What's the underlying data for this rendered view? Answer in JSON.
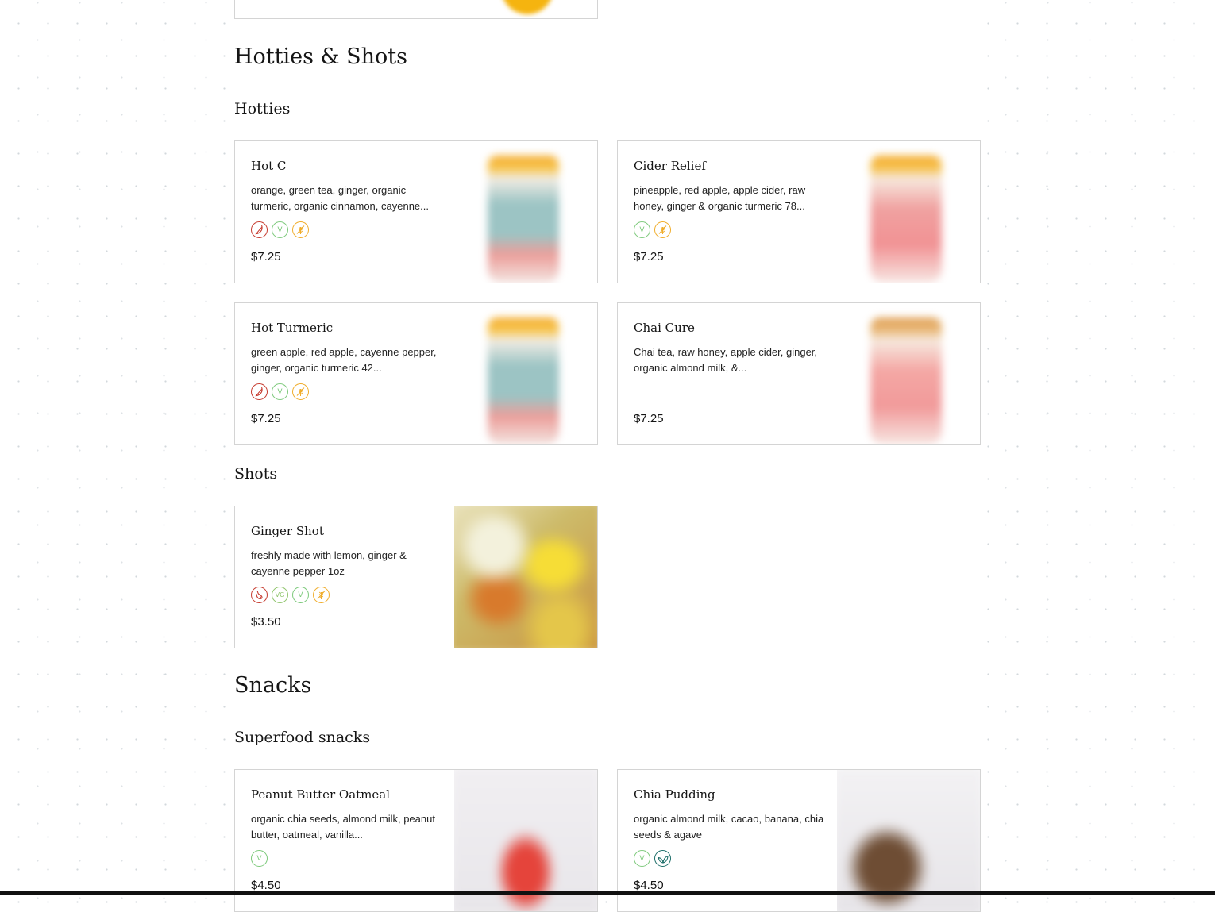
{
  "sections": [
    {
      "title": "Hotties & Shots",
      "subsections": [
        {
          "title": "Hotties",
          "items": [
            {
              "name": "Hot C",
              "desc": "orange, green tea, ginger, organic turmeric, organic cinnamon, cayenne...",
              "price": "$7.25",
              "badges": [
                "spicy-icon",
                "vegan-icon",
                "gluten-free-icon"
              ]
            },
            {
              "name": "Cider Relief",
              "desc": "pineapple, red apple, apple cider, raw honey, ginger & organic turmeric 78...",
              "price": "$7.25",
              "badges": [
                "vegan-icon",
                "gluten-free-icon"
              ]
            },
            {
              "name": "Hot Turmeric",
              "desc": "green apple, red apple, cayenne pepper, ginger, organic turmeric 42...",
              "price": "$7.25",
              "badges": [
                "spicy-icon",
                "vegan-icon",
                "gluten-free-icon"
              ]
            },
            {
              "name": "Chai Cure",
              "desc": "Chai tea, raw honey, apple cider, ginger, organic almond milk, &...",
              "price": "$7.25",
              "badges": []
            }
          ]
        },
        {
          "title": "Shots",
          "items": [
            {
              "name": "Ginger Shot",
              "desc": "freshly made with lemon, ginger & cayenne pepper 1oz",
              "price": "$3.50",
              "badges": [
                "spicy-icon",
                "vegetarian-icon",
                "vegan-icon",
                "gluten-free-icon"
              ]
            }
          ]
        }
      ]
    },
    {
      "title": "Snacks",
      "subsections": [
        {
          "title": "Superfood snacks",
          "items": [
            {
              "name": "Peanut Butter Oatmeal",
              "desc": "organic chia seeds, almond milk, peanut butter, oatmeal, vanilla...",
              "price": "$4.50",
              "badges": [
                "vegan-icon"
              ]
            },
            {
              "name": "Chia Pudding",
              "desc": "organic almond milk, cacao, banana, chia seeds & agave",
              "price": "$4.50",
              "badges": [
                "vegan-icon",
                "organic-icon"
              ]
            }
          ]
        }
      ]
    }
  ],
  "badge_labels": {
    "vegan": "V",
    "vegetarian": "VG"
  },
  "colors": {
    "spicy": "#c63a2e",
    "vegan": "#7cc97a",
    "gluten_free": "#f0ad2c",
    "vegetarian": "#8ec46a",
    "organic": "#1f6f6a"
  }
}
